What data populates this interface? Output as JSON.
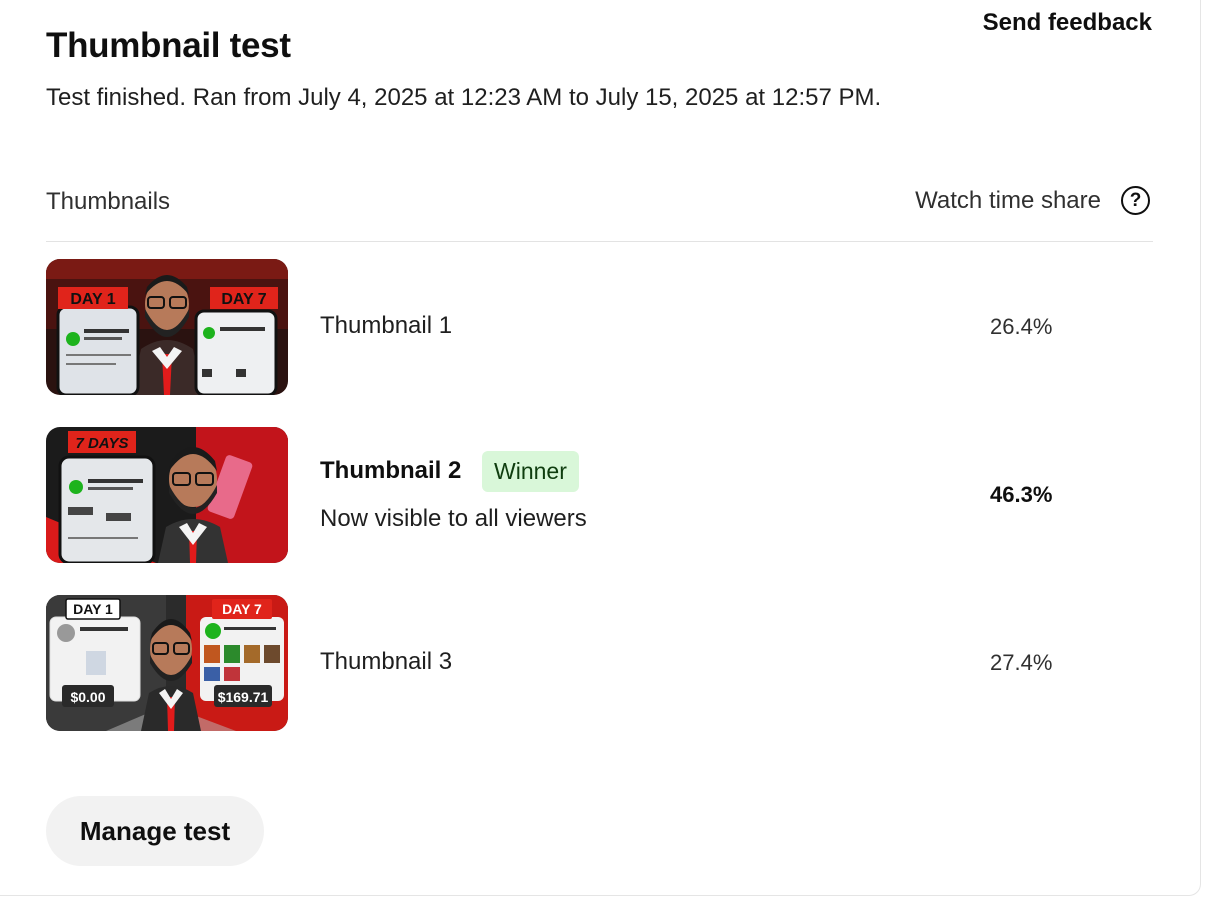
{
  "header": {
    "title": "Thumbnail test",
    "feedback_label": "Send feedback",
    "subtitle": "Test finished. Ran from July 4, 2025 at 12:23 AM to July 15, 2025 at 12:57 PM."
  },
  "table": {
    "col_thumbnails": "Thumbnails",
    "col_share": "Watch time share",
    "help_icon": "?",
    "rows": [
      {
        "name": "Thumbnail 1",
        "share": "26.4%",
        "thumb_text_left": "DAY 1",
        "thumb_text_right": "DAY 7"
      },
      {
        "name": "Thumbnail 2",
        "share": "46.3%",
        "badge": "Winner",
        "note": "Now visible to all viewers",
        "thumb_text_left": "7 DAYS"
      },
      {
        "name": "Thumbnail 3",
        "share": "27.4%",
        "thumb_text_left": "DAY 1",
        "thumb_text_right": "DAY 7",
        "thumb_amount_left": "$0.00",
        "thumb_amount_right": "$169.71"
      }
    ]
  },
  "footer": {
    "manage_label": "Manage test"
  },
  "colors": {
    "winner_bg": "#d9f7d9",
    "thumb_red": "#e0241b",
    "button_bg": "#f2f2f2"
  }
}
